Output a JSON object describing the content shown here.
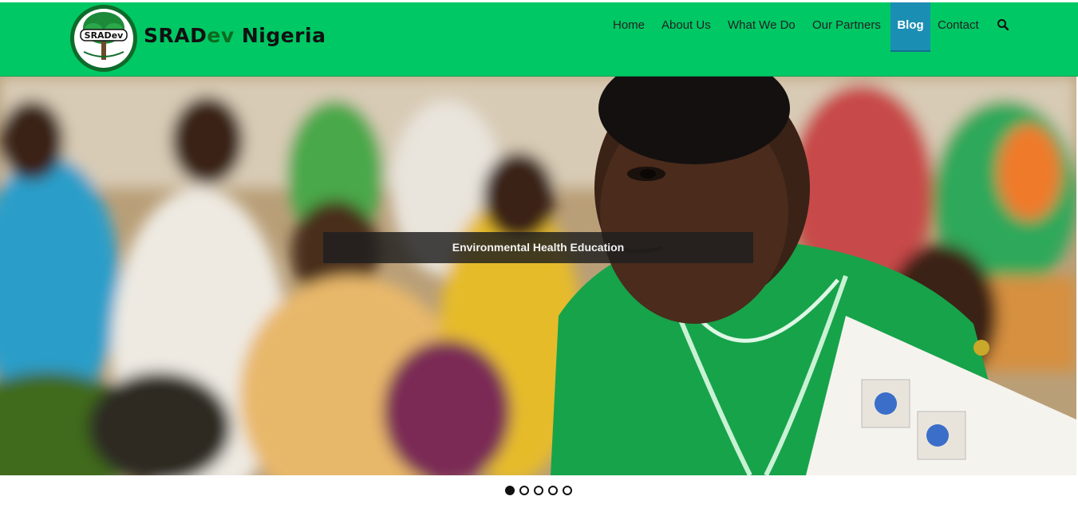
{
  "brand": {
    "name_pre": "SRAD",
    "name_ev": "ev",
    "name_post": " Nigeria",
    "logo_text": "SRADev"
  },
  "nav": {
    "items": [
      {
        "label": "Home"
      },
      {
        "label": "About Us"
      },
      {
        "label": "What We Do"
      },
      {
        "label": "Our Partners"
      },
      {
        "label": "Blog",
        "active": true
      },
      {
        "label": "Contact"
      }
    ],
    "search_icon": "search-icon"
  },
  "slider": {
    "caption": "Environmental Health Education",
    "slide_count": 5,
    "active_index": 0
  },
  "colors": {
    "header_green": "#00c864",
    "active_blue": "#1b8eb4"
  }
}
